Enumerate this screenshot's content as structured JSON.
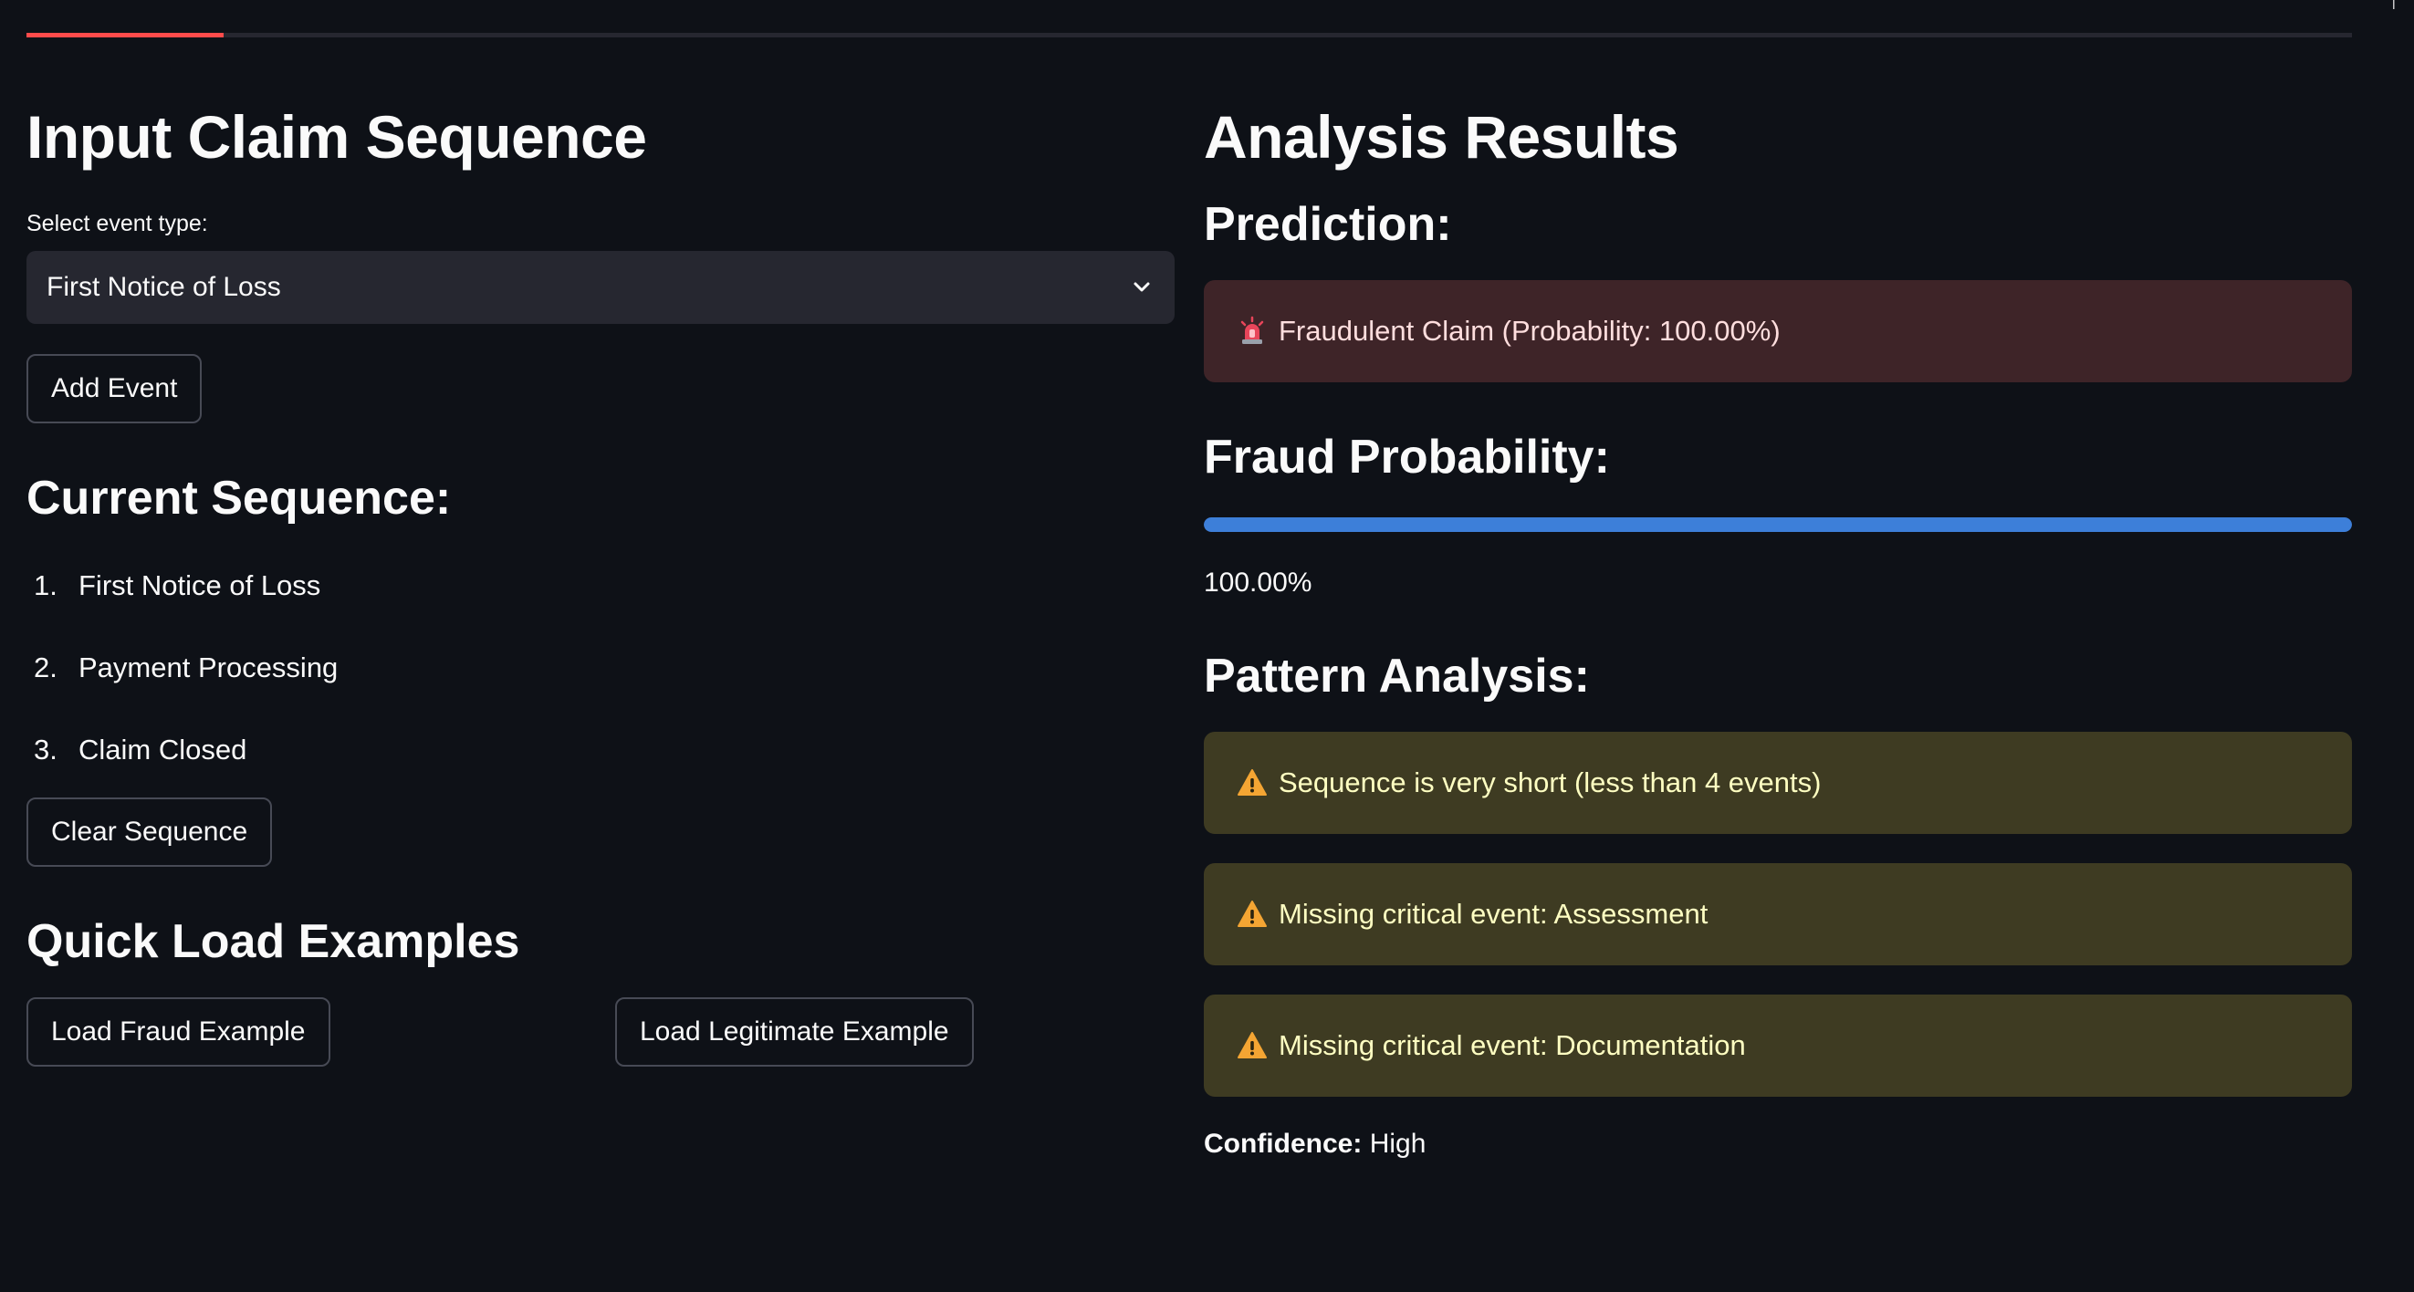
{
  "left": {
    "title": "Input Claim Sequence",
    "select_label": "Select event type:",
    "select_value": "First Notice of Loss",
    "add_button": "Add Event",
    "sequence_heading": "Current Sequence:",
    "sequence": [
      {
        "num": "1.",
        "label": "First Notice of Loss"
      },
      {
        "num": "2.",
        "label": "Payment Processing"
      },
      {
        "num": "3.",
        "label": "Claim Closed"
      }
    ],
    "clear_button": "Clear Sequence",
    "examples_heading": "Quick Load Examples",
    "fraud_example_button": "Load Fraud Example",
    "legit_example_button": "Load Legitimate Example"
  },
  "right": {
    "title": "Analysis Results",
    "prediction_heading": "Prediction:",
    "prediction_text": "Fraudulent Claim (Probability: 100.00%)",
    "probability_heading": "Fraud Probability:",
    "probability_value": 1.0,
    "probability_text": "100.00%",
    "pattern_heading": "Pattern Analysis:",
    "warnings": [
      "Sequence is very short (less than 4 events)",
      "Missing critical event: Assessment",
      "Missing critical event: Documentation"
    ],
    "confidence_label": "Confidence:",
    "confidence_value": "High"
  },
  "icons": {
    "prediction_icon": "rotating-light-icon",
    "warning_icon": "warning-icon",
    "select_icon": "chevron-down-icon"
  },
  "colors": {
    "background": "#0e1117",
    "accent_tab": "#ff4b4b",
    "progress": "#3d7fd9",
    "error_bg": "#3e2428",
    "warning_bg": "#3e3b22"
  }
}
